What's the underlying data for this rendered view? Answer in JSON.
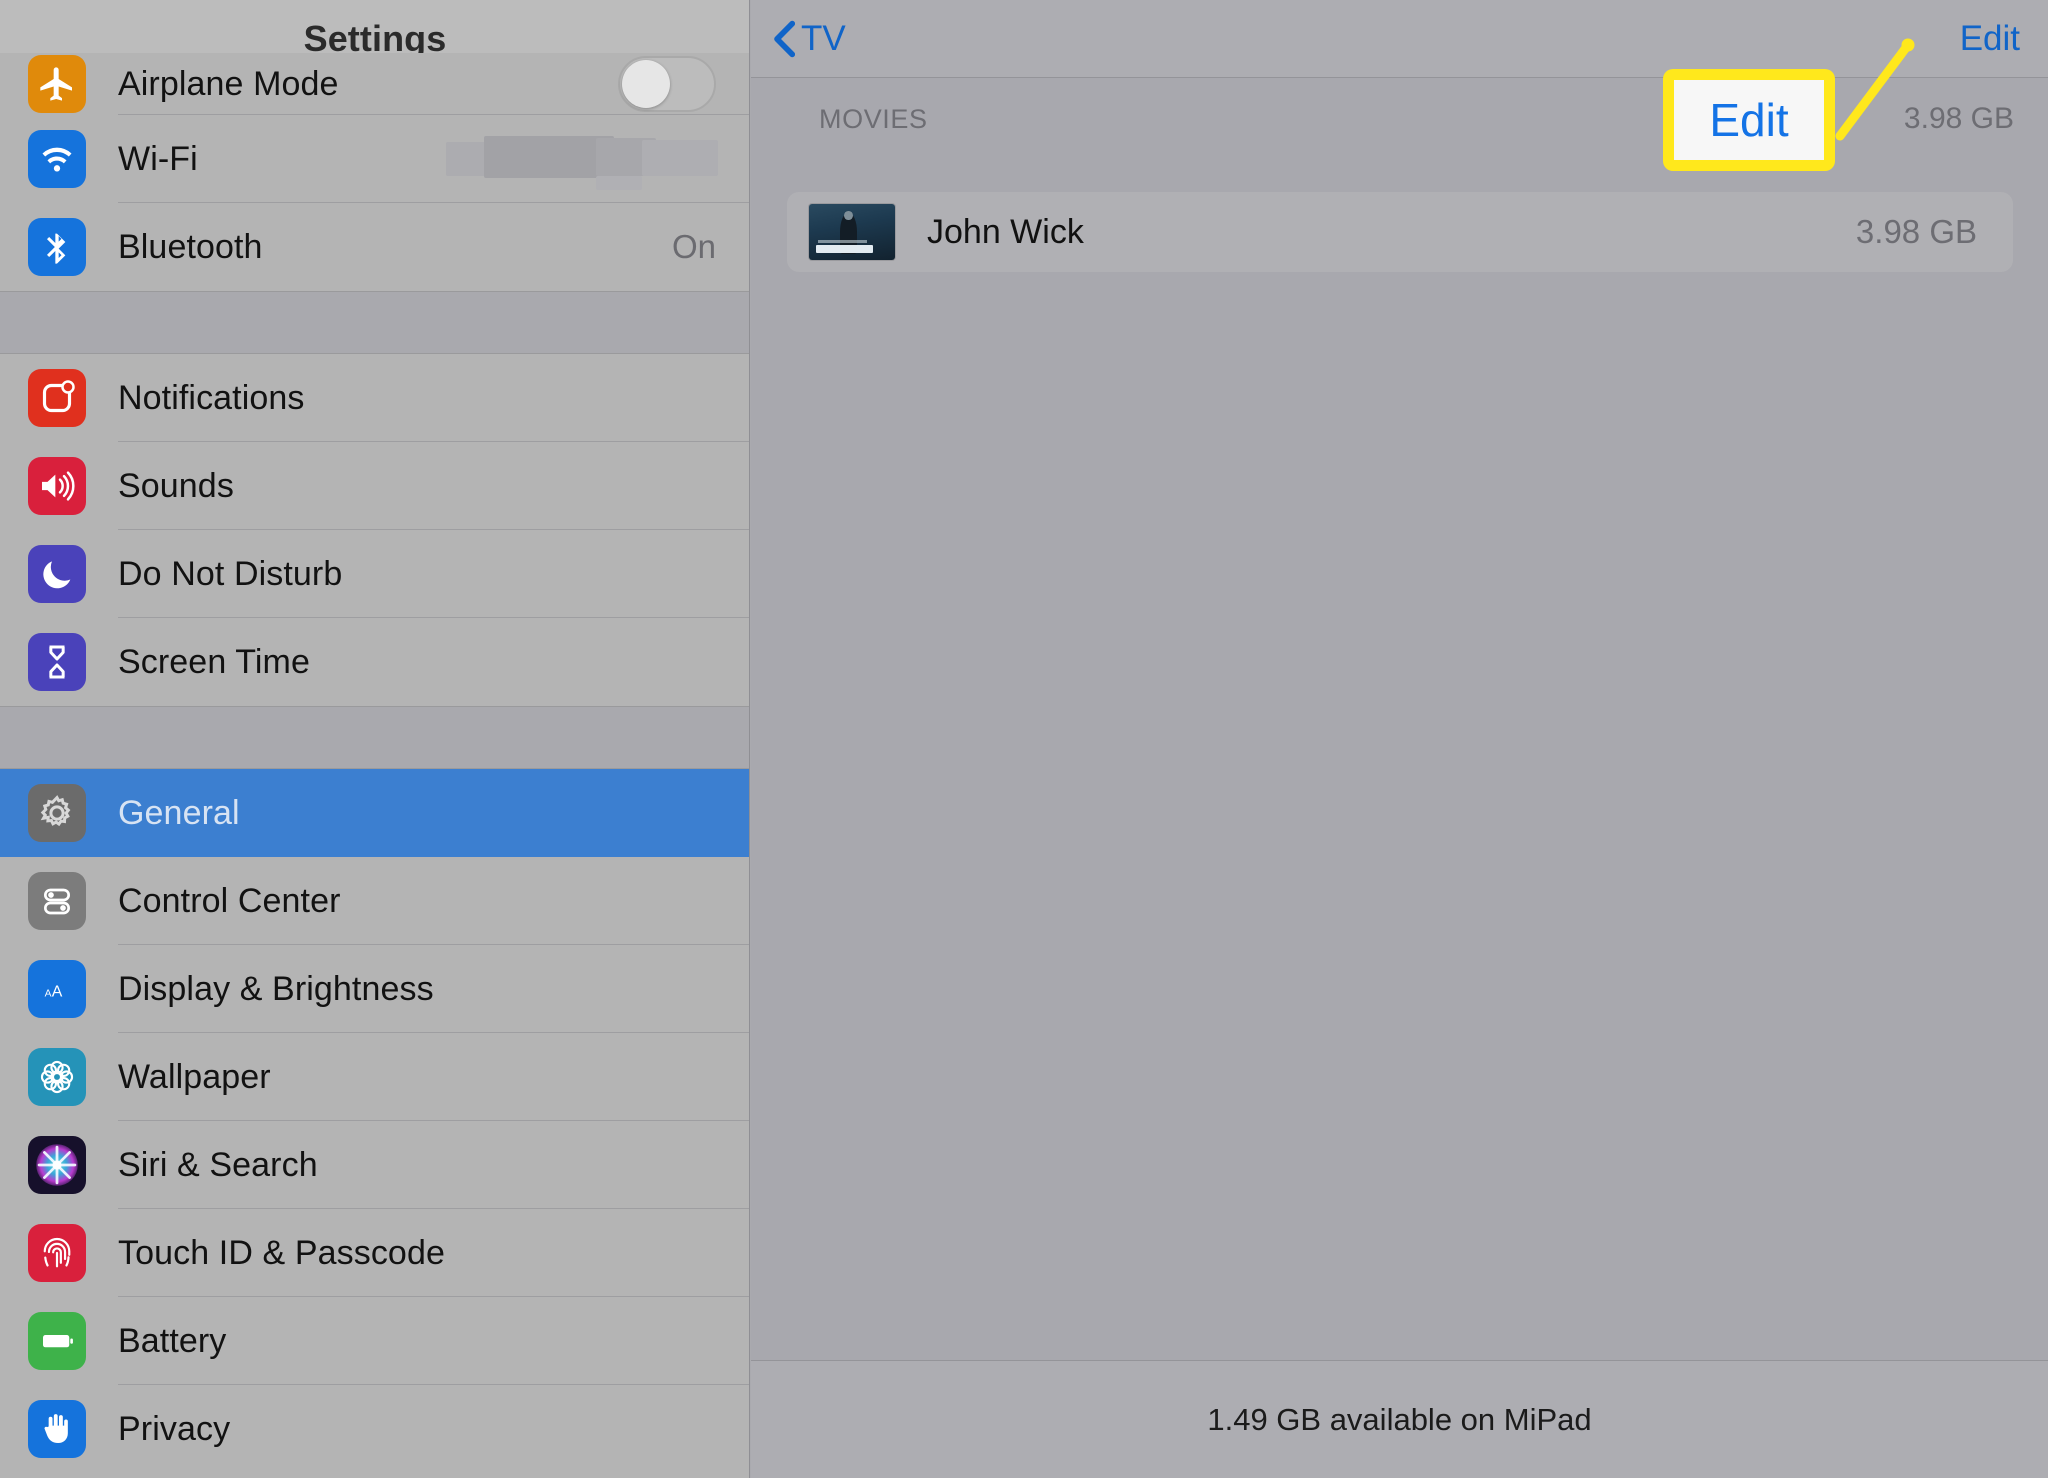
{
  "sidebar": {
    "title": "Settings",
    "groups": [
      {
        "id": "connectivity",
        "rows": [
          {
            "label": "Airplane Mode",
            "icon": "airplane-icon",
            "icon_color": "#e08a0b",
            "control": "toggle",
            "toggle_on": false
          },
          {
            "label": "Wi-Fi",
            "icon": "wifi-icon",
            "icon_color": "#1573dc",
            "control": "redacted"
          },
          {
            "label": "Bluetooth",
            "icon": "bluetooth-icon",
            "icon_color": "#1573dc",
            "control": "value",
            "value": "On"
          }
        ]
      },
      {
        "id": "alerts",
        "rows": [
          {
            "label": "Notifications",
            "icon": "notifications-icon",
            "icon_color": "#e0301e",
            "control": "none"
          },
          {
            "label": "Sounds",
            "icon": "sounds-icon",
            "icon_color": "#d9203c",
            "control": "none"
          },
          {
            "label": "Do Not Disturb",
            "icon": "moon-icon",
            "icon_color": "#4a42ba",
            "control": "none"
          },
          {
            "label": "Screen Time",
            "icon": "hourglass-icon",
            "icon_color": "#4a42ba",
            "control": "none"
          }
        ]
      },
      {
        "id": "system",
        "rows": [
          {
            "label": "General",
            "icon": "gear-icon",
            "icon_color": "#6b6b6b",
            "control": "none",
            "selected": true
          },
          {
            "label": "Control Center",
            "icon": "control-center-icon",
            "icon_color": "#7c7c7c",
            "control": "none"
          },
          {
            "label": "Display & Brightness",
            "icon": "display-brightness-icon",
            "icon_color": "#1573dc",
            "control": "none"
          },
          {
            "label": "Wallpaper",
            "icon": "wallpaper-icon",
            "icon_color": "#2593b8",
            "control": "none"
          },
          {
            "label": "Siri & Search",
            "icon": "siri-icon",
            "icon_color": "#1b1533",
            "control": "none"
          },
          {
            "label": "Touch ID & Passcode",
            "icon": "touch-id-icon",
            "icon_color": "#d9203c",
            "control": "none"
          },
          {
            "label": "Battery",
            "icon": "battery-icon",
            "icon_color": "#3eb24a",
            "control": "none"
          },
          {
            "label": "Privacy",
            "icon": "privacy-hand-icon",
            "icon_color": "#1573dc",
            "control": "none"
          }
        ]
      }
    ]
  },
  "detail": {
    "back_label": "TV",
    "edit_label": "Edit",
    "section_label": "MOVIES",
    "section_size": "3.98 GB",
    "movies": [
      {
        "title": "John Wick",
        "size": "3.98 GB",
        "poster": "john-wick-poster"
      }
    ],
    "footer_text": "1.49 GB available on MiPad"
  },
  "annotation": {
    "callout_label": "Edit",
    "highlight_color": "#ffe81c",
    "callout_text_color": "#1473e6"
  }
}
